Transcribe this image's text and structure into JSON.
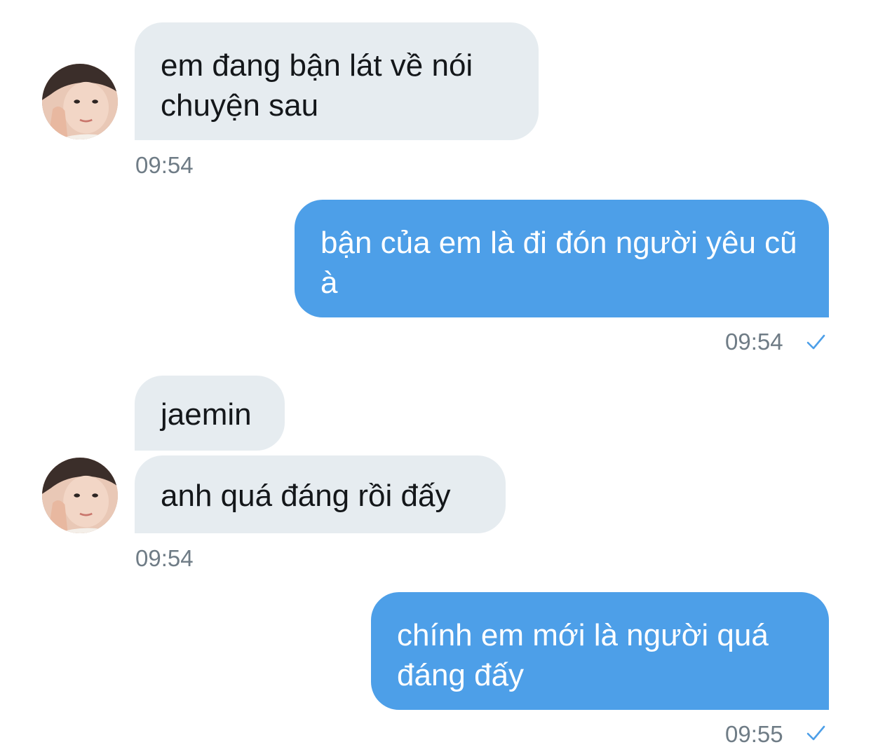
{
  "conversation": {
    "contact_avatar": "contact-avatar",
    "messages": [
      {
        "side": "received",
        "text": "em đang bận lát về nói chuyện sau",
        "time": "09:54"
      },
      {
        "side": "sent",
        "text": "bận của em là đi đón người yêu cũ à",
        "time": "09:54",
        "status_icon": "check-icon"
      },
      {
        "side": "received",
        "text": "jaemin"
      },
      {
        "side": "received",
        "text": "anh quá đáng rồi đấy",
        "time": "09:54"
      },
      {
        "side": "sent",
        "text": "chính em mới là người quá đáng đấy",
        "time": "09:55",
        "status_icon": "check-icon"
      }
    ]
  },
  "colors": {
    "received_bubble": "#e6ecf0",
    "sent_bubble": "#4d9fe8",
    "timestamp": "#6f7c86",
    "check": "#4d9fe8"
  }
}
